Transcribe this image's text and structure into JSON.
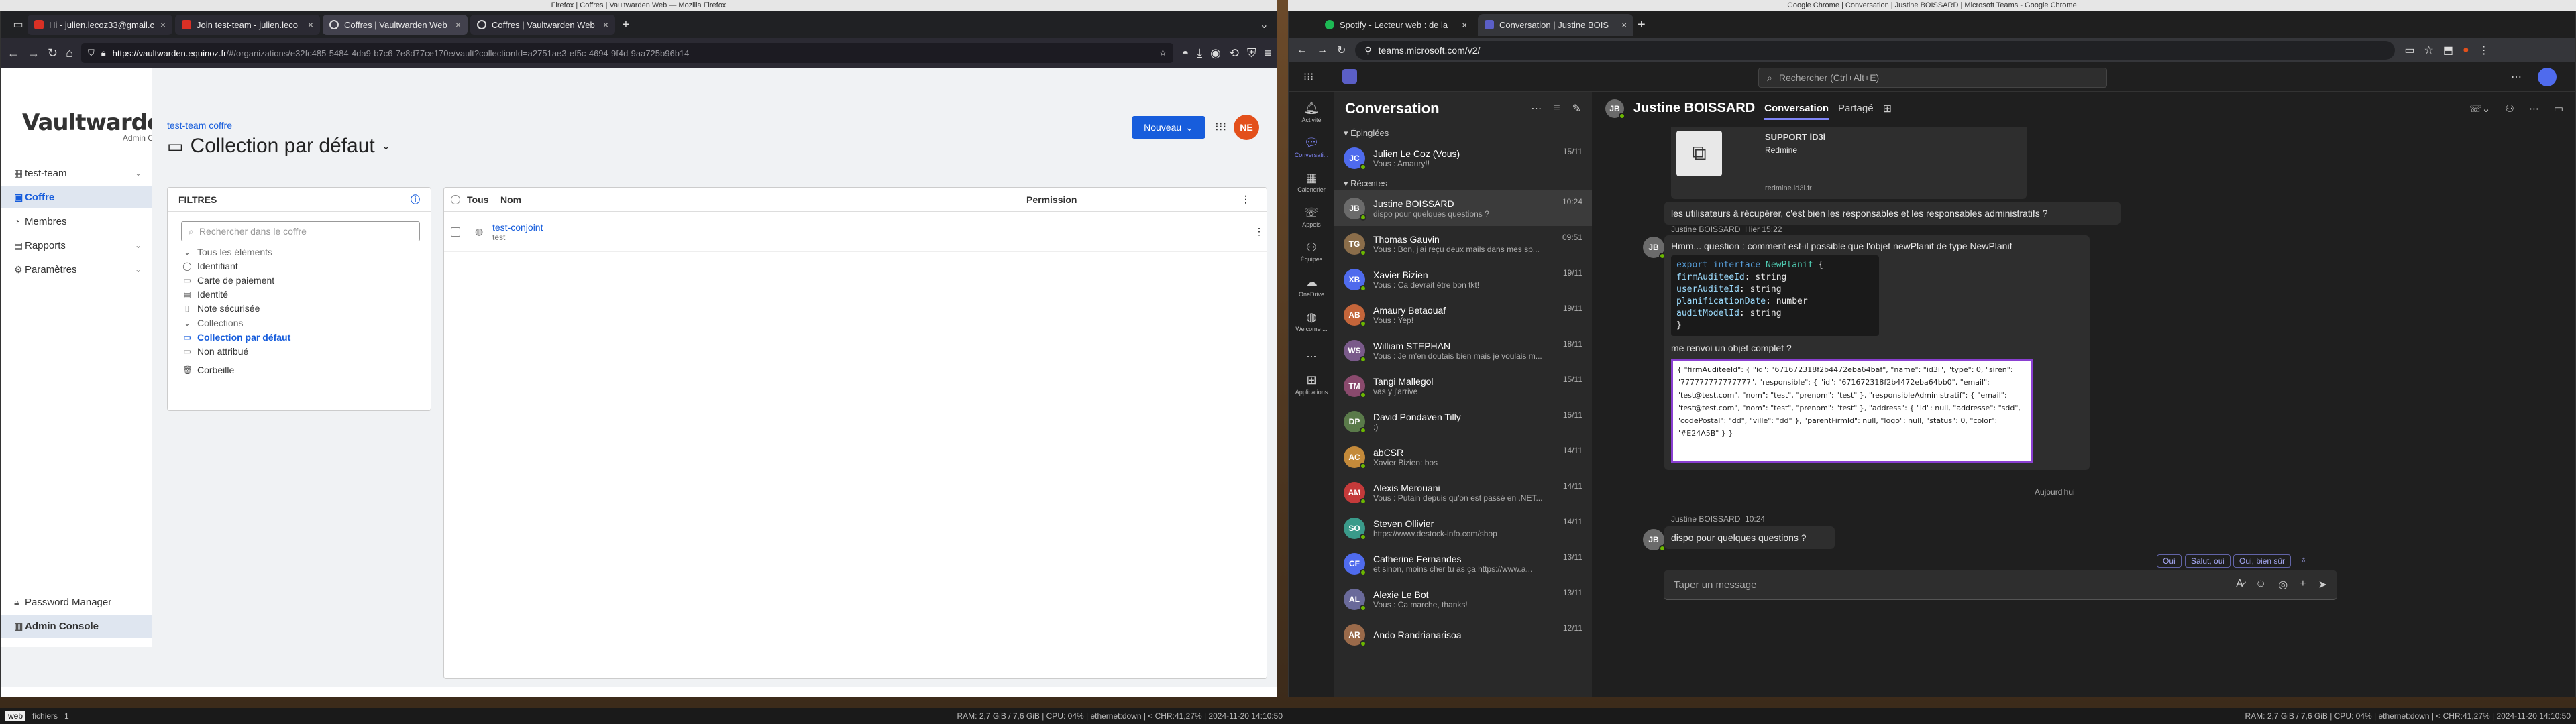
{
  "desktop": {
    "accent": "#175ddc"
  },
  "firefox": {
    "title": "Firefox | Coffres | Vaultwarden Web — Mozilla Firefox",
    "tabs": [
      {
        "label": "Hi - julien.lecoz33@gmail.c",
        "favcolor": "#d93025"
      },
      {
        "label": "Join test-team - julien.leco",
        "favcolor": "#d93025"
      },
      {
        "label": "Coffres | Vaultwarden Web",
        "favcolor": "#ffffff"
      },
      {
        "label": "Coffres | Vaultwarden Web",
        "favcolor": "#ffffff"
      }
    ],
    "url": {
      "host": "https://vaultwarden.equinoz.fr",
      "path": "/#/organizations/e32fc485-5484-4da9-b7c6-7e8d77ce170e/vault?collectionId=a2751ae3-ef5c-4694-9f4d-9aa725b96b14"
    }
  },
  "vaultwarden": {
    "logo": "Vaultwarden",
    "logo_sub": "Admin Console",
    "nav": [
      {
        "label": "test-team",
        "icon": "org-icon",
        "chev": true
      },
      {
        "label": "Coffre",
        "icon": "vault-icon",
        "active": true
      },
      {
        "label": "Membres",
        "icon": "members-icon"
      },
      {
        "label": "Rapports",
        "icon": "reports-icon",
        "chev": true
      },
      {
        "label": "Paramètres",
        "icon": "settings-icon",
        "chev": true
      }
    ],
    "bottom_nav": [
      {
        "label": "Password Manager"
      },
      {
        "label": "Admin Console"
      }
    ],
    "breadcrumb": "test-team coffre",
    "title": "Collection par défaut",
    "new_button": "Nouveau",
    "avatar": "NE",
    "filters": {
      "title": "FILTRES",
      "search_placeholder": "Rechercher dans le coffre",
      "all": "Tous les éléments",
      "types": [
        "Identifiant",
        "Carte de paiement",
        "Identité",
        "Note sécurisée"
      ],
      "collections_label": "Collections",
      "collections": [
        "Collection par défaut",
        "Non attribué"
      ],
      "trash": "Corbeille"
    },
    "table": {
      "headers": {
        "all": "Tous",
        "name": "Nom",
        "permission": "Permission"
      },
      "rows": [
        {
          "name": "test-conjoint",
          "sub": "test"
        }
      ]
    }
  },
  "chrome": {
    "title": "Google Chrome | Conversation | Justine BOISSARD | Microsoft Teams - Google Chrome",
    "tabs": [
      {
        "label": "Spotify - Lecteur web : de la",
        "favcolor": "#1db954"
      },
      {
        "label": "Conversation | Justine BOIS",
        "favcolor": "#5b5fc7"
      }
    ],
    "url": "teams.microsoft.com/v2/"
  },
  "teams": {
    "search_placeholder": "Rechercher (Ctrl+Alt+E)",
    "rail": [
      {
        "label": "Activité",
        "icon": "bell-icon"
      },
      {
        "label": "Conversati...",
        "icon": "chat-icon",
        "active": true
      },
      {
        "label": "Calendrier",
        "icon": "calendar-icon"
      },
      {
        "label": "Appels",
        "icon": "phone-icon"
      },
      {
        "label": "Équipes",
        "icon": "teams-icon"
      },
      {
        "label": "OneDrive",
        "icon": "cloud-icon"
      },
      {
        "label": "Welcome ...",
        "icon": "welcome-icon"
      },
      {
        "label": "...",
        "icon": "more-icon"
      },
      {
        "label": "Applications",
        "icon": "apps-icon"
      }
    ],
    "list_title": "Conversation",
    "pinned_label": "Épinglées",
    "recent_label": "Récentes",
    "pinned": [
      {
        "name": "Julien Le Coz (Vous)",
        "preview": "Vous : Amaury!!",
        "time": "15/11",
        "initials": "JC",
        "color": "#4f6bed"
      }
    ],
    "recent": [
      {
        "name": "Justine BOISSARD",
        "preview": "dispo pour quelques questions ?",
        "time": "10:24",
        "initials": "JB",
        "color": "#6b6b6b",
        "active": true
      },
      {
        "name": "Thomas Gauvin",
        "preview": "Vous : Bon, j'ai reçu deux mails dans mes sp...",
        "time": "09:51",
        "initials": "TG",
        "color": "#8a6d4a"
      },
      {
        "name": "Xavier Bizien",
        "preview": "Vous : Ca devrait être bon tkt!",
        "time": "19/11",
        "initials": "XB",
        "color": "#4f6bed"
      },
      {
        "name": "Amaury Betaouaf",
        "preview": "Vous : Yep!",
        "time": "19/11",
        "initials": "AB",
        "color": "#c4653a"
      },
      {
        "name": "William STEPHAN",
        "preview": "Vous : Je m'en doutais bien mais je voulais m...",
        "time": "18/11",
        "initials": "WS",
        "color": "#7a5a8a"
      },
      {
        "name": "Tangi Mallegol",
        "preview": "vas y j'arrive",
        "time": "15/11",
        "initials": "TM",
        "color": "#8a4a6d"
      },
      {
        "name": "David Pondaven Tilly",
        "preview": ":)",
        "time": "15/11",
        "initials": "DP",
        "color": "#5a7a4a"
      },
      {
        "name": "abCSR",
        "preview": "Xavier Bizien: bos",
        "time": "14/11",
        "initials": "AC",
        "color": "#c48a3a"
      },
      {
        "name": "Alexis Merouani",
        "preview": "Vous : Putain depuis qu'on est passé en .NET...",
        "time": "14/11",
        "initials": "AM",
        "color": "#c43a3a"
      },
      {
        "name": "Steven Ollivier",
        "preview": "https://www.destock-info.com/shop",
        "time": "14/11",
        "initials": "SO",
        "color": "#3a9a8a"
      },
      {
        "name": "Catherine Fernandes",
        "preview": "et sinon, moins cher tu as ça https://www.a...",
        "time": "13/11",
        "initials": "CF",
        "color": "#4f6bed"
      },
      {
        "name": "Alexie Le Bot",
        "preview": "Vous : Ca marche, thanks!",
        "time": "13/11",
        "initials": "AL",
        "color": "#6a6a9a"
      },
      {
        "name": "Ando Randrianarisoa",
        "preview": "",
        "time": "12/11",
        "initials": "AR",
        "color": "#9a6a4a"
      }
    ],
    "chat": {
      "name": "Justine BOISSARD",
      "tabs": [
        "Conversation",
        "Partagé"
      ],
      "card": {
        "title": "SUPPORT iD3i",
        "sub": "Redmine",
        "link": "redmine.id3i.fr"
      },
      "msg1": "les utilisateurs à récupérer, c'est bien les responsables et les responsables administratifs ?",
      "head2": {
        "name": "Justine BOISSARD",
        "time": "Hier 15:22"
      },
      "msg2": "Hmm... question :  comment est-il possible que l'objet newPlanif de type NewPlanif",
      "code": [
        {
          "kw": "export interface",
          "ty": " NewPlanif ",
          "rest": "{"
        },
        {
          "pr": "  firmAuditeeId",
          "rest": ": string"
        },
        {
          "pr": "  userAuditeId",
          "rest": ": string"
        },
        {
          "pr": "  planificationDate",
          "rest": ": number"
        },
        {
          "pr": "  auditModelId",
          "rest": ": string"
        },
        {
          "rest": "}"
        }
      ],
      "msg2b": "me renvoi un objet complet ?",
      "json": "{ \"firmAuditeeId\": { \"id\": \"671672318f2b4472eba64baf\", \"name\": \"id3i\", \"type\": 0, \"siren\": \"777777777777777\", \"responsible\": { \"id\": \"671672318f2b4472eba64bb0\", \"email\": \"test@test.com\", \"nom\": \"test\", \"prenom\": \"test\" }, \"responsibleAdministratif\": { \"email\": \"test@test.com\", \"nom\": \"test\", \"prenom\": \"test\" }, \"address\": { \"id\": null, \"addresse\": \"sdd\", \"codePostal\": \"dd\", \"ville\": \"dd\" }, \"parentFirmId\": null, \"logo\": null, \"status\": 0, \"color\": \"#E24A5B\" } }",
      "divider": "Aujourd'hui",
      "head3": {
        "name": "Justine BOISSARD",
        "time": "10:24"
      },
      "msg3": "dispo pour quelques questions ?",
      "suggestions": [
        "Oui",
        "Salut, oui",
        "Oui, bien sûr"
      ],
      "compose_placeholder": "Taper un message"
    }
  },
  "taskbar_left": {
    "workspaces": [
      "web",
      "fichiers",
      "1"
    ],
    "status": "RAM: 2,7 GiB / 7,6 GiB | CPU: 04% | ethernet:down | < CHR:41,27% | 2024-11-20 14:10:50"
  },
  "taskbar_right": {
    "status": "RAM: 2,7 GiB / 7,6 GiB | CPU: 04% | ethernet:down | < CHR:41,27% | 2024-11-20 14:10:50"
  }
}
